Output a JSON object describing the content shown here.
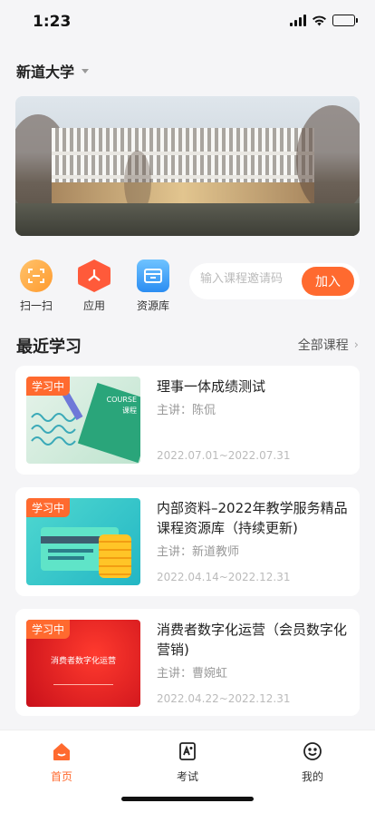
{
  "status": {
    "time": "1:23"
  },
  "header": {
    "school": "新道大学"
  },
  "quick": [
    {
      "label": "扫一扫",
      "icon": "scan-icon"
    },
    {
      "label": "应用",
      "icon": "apps-icon"
    },
    {
      "label": "资源库",
      "icon": "resource-icon"
    }
  ],
  "join": {
    "placeholder": "输入课程邀请码",
    "button": "加入"
  },
  "section": {
    "title": "最近学习",
    "more": "全部课程"
  },
  "courses": [
    {
      "tag": "学习中",
      "title": "理事一体成绩测试",
      "teacher": "主讲：陈侃",
      "dates": "2022.07.01~2022.07.31",
      "thumb_text": "COURSE 课程"
    },
    {
      "tag": "学习中",
      "title": "内部资料–2022年教学服务精品课程资源库（持续更新)",
      "teacher": "主讲：新道教师",
      "dates": "2022.04.14~2022.12.31"
    },
    {
      "tag": "学习中",
      "title": "消费者数字化运营（会员数字化营销)",
      "teacher": "主讲：曹婉虹",
      "dates": "2022.04.22~2022.12.31",
      "thumb_text": "消费者数字化运营"
    }
  ],
  "tabs": [
    {
      "label": "首页"
    },
    {
      "label": "考试"
    },
    {
      "label": "我的"
    }
  ],
  "colors": {
    "accent": "#ff6a2f",
    "background": "#f5f5f7"
  }
}
